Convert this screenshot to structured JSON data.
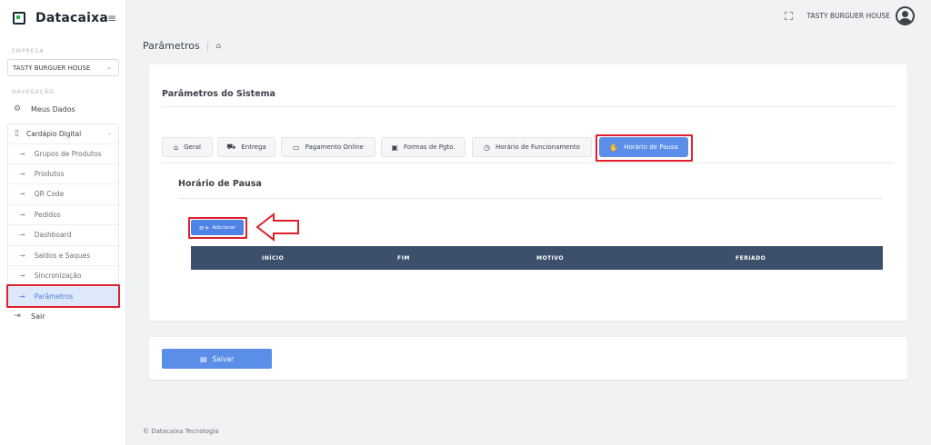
{
  "brand": {
    "name": "Datacaixa",
    "logo_icon": "square-logo-icon",
    "menu_icon": "hamburger-icon"
  },
  "header": {
    "user_name": "TASTY BURGUER HOUSE",
    "expand_icon": "fullscreen-icon",
    "avatar_icon": "user-avatar-icon"
  },
  "sidebar": {
    "empresa_label": "EMPRESA",
    "company_select_value": "TASTY BURGUER HOUSE",
    "navegacao_label": "NAVEGAÇÃO",
    "meus_dados": "Meus Dados",
    "cardapio": "Cardápio Digital",
    "sub_items": [
      "Grupos de Produtos",
      "Produtos",
      "QR Code",
      "Pedidos",
      "Dashboard",
      "Saldos e Saques",
      "Sincronização",
      "Parâmetros"
    ],
    "sair": "Sair"
  },
  "breadcrumb": {
    "title": "Parâmetros"
  },
  "main": {
    "card_title": "Parâmetros do Sistema",
    "tabs": [
      {
        "label": "Geral",
        "icon": "home-icon"
      },
      {
        "label": "Entrega",
        "icon": "truck-icon"
      },
      {
        "label": "Pagamento Online",
        "icon": "card-icon"
      },
      {
        "label": "Formas de Pgto.",
        "icon": "money-icon"
      },
      {
        "label": "Horário de Funcionamento",
        "icon": "clock-icon"
      },
      {
        "label": "Horário de Pausa",
        "icon": "pause-hand-icon"
      }
    ],
    "section_title": "Horário de Pausa",
    "add_button": "Adicionar",
    "table_headers": [
      "INÍCIO",
      "FIM",
      "MOTIVO",
      "FERIADO"
    ],
    "save_button": "Salvar"
  },
  "footer": {
    "text": "© Datacaixa Tecnologia"
  },
  "colors": {
    "accent": "#5b8ee9",
    "table_header": "#3d506b",
    "highlight": "#e0202a",
    "active_nav_bg": "#dde8fa"
  }
}
